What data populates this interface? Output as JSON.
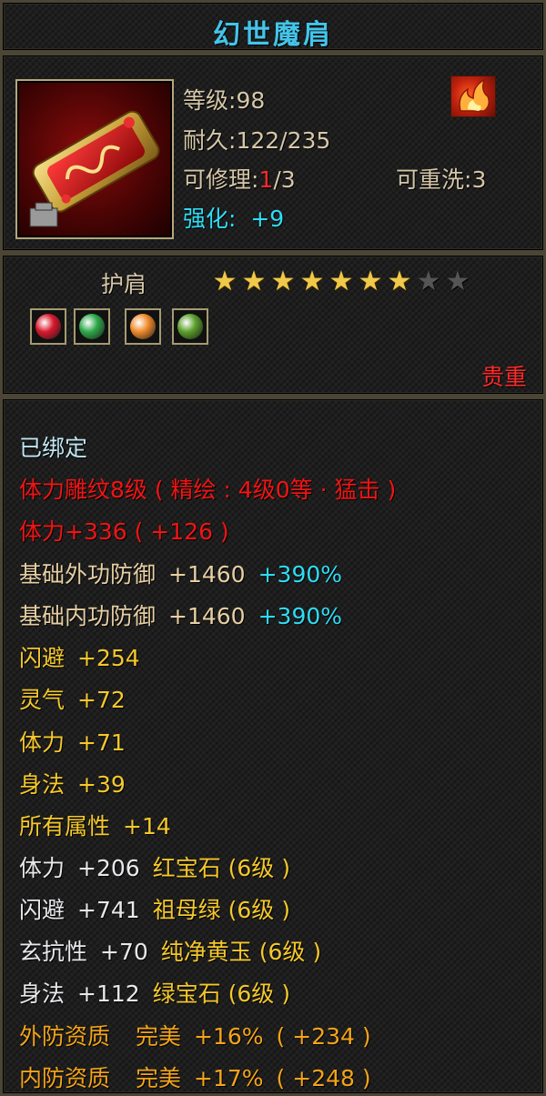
{
  "title": "幻世魔肩",
  "item": {
    "level_label": "等级",
    "level_value": "98",
    "durability_label": "耐久",
    "durability_value": "122/235",
    "repair_label": "可修理",
    "repair_used": "1",
    "repair_total": "/3",
    "rewash_label": "可重洗",
    "rewash_value": "3",
    "enhance_label": "强化",
    "enhance_value": "+9",
    "icon_name": "shoulder-armor-icon",
    "class_icon_name": "flame-class-icon"
  },
  "type": {
    "slot": "护肩",
    "stars_total": 9,
    "stars_filled": 7,
    "rarity": "贵重",
    "gems": [
      {
        "name": "red-gem-icon",
        "color": "#d8182c"
      },
      {
        "name": "green-gem-icon",
        "color": "#2ea84a"
      },
      {
        "name": "orange-gem-icon",
        "color": "#f08a2a"
      },
      {
        "name": "jade-gem-icon",
        "color": "#5a9e2a"
      }
    ]
  },
  "stats": {
    "bound": "已绑定",
    "engraving": "体力雕纹8级 ( 精绘 : 4级0等 · 猛击 )",
    "vitality_total": "体力+336 ( +126 )",
    "outer_def_label": "基础外功防御",
    "outer_def_value": "+1460",
    "outer_def_pct": "+390%",
    "inner_def_label": "基础内功防御",
    "inner_def_value": "+1460",
    "inner_def_pct": "+390%",
    "attrs": [
      {
        "label": "闪避",
        "value": "+254"
      },
      {
        "label": "灵气",
        "value": "+72"
      },
      {
        "label": "体力",
        "value": "+71"
      },
      {
        "label": "身法",
        "value": "+39"
      },
      {
        "label": "所有属性",
        "value": "+14"
      }
    ],
    "gem_lines": [
      {
        "label": "体力",
        "value": "+206",
        "gem": "红宝石 (6级 )"
      },
      {
        "label": "闪避",
        "value": "+741",
        "gem": "祖母绿 (6级 )"
      },
      {
        "label": "玄抗性",
        "value": "+70",
        "gem": "纯净黄玉 (6级 )"
      },
      {
        "label": "身法",
        "value": "+112",
        "gem": "绿宝石 (6级 )"
      }
    ],
    "quality_lines": [
      {
        "label": "外防资质",
        "grade": "完美",
        "pct": "+16%",
        "bonus": "( +234 )"
      },
      {
        "label": "内防资质",
        "grade": "完美",
        "pct": "+17%",
        "bonus": "( +248 )"
      }
    ]
  },
  "colors": {
    "title": "#44c4e8",
    "rarity": "#ff2a2a",
    "engraving": "#f21414",
    "attribute": "#f5c82c",
    "quality": "#f3a41a"
  }
}
